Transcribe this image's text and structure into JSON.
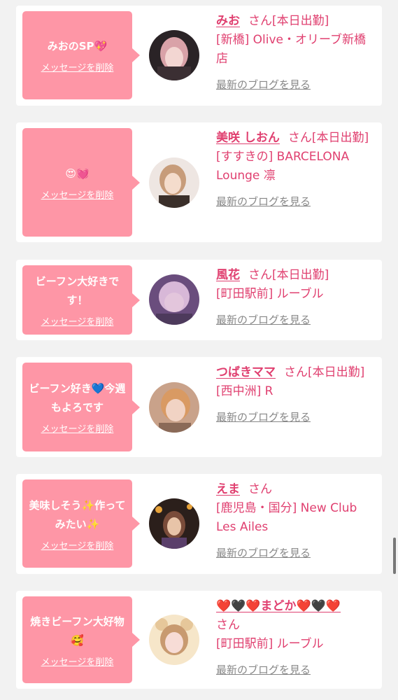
{
  "cards": [
    {
      "message": "みおのSP💖",
      "delete_label": "メッセージを削除",
      "name": "みお",
      "san": "さん",
      "status": "[本日出勤]",
      "shop": "[新橋] Olive・オリーブ新橋店",
      "blog_link": "最新のブログを見る",
      "avatar_icon": "girl-portrait-dark",
      "avatar_colors": [
        "#2a2326",
        "#d9a2a8",
        "#f3d6d2"
      ]
    },
    {
      "message": "😍💓",
      "delete_label": "メッセージを削除",
      "name": "美咲 しおん",
      "san": "さん",
      "status": "[本日出勤]",
      "shop": "[すすきの] BARCELONA Lounge 凛",
      "blog_link": "最新のブログを見る",
      "avatar_icon": "girl-portrait-light",
      "avatar_colors": [
        "#eee6e2",
        "#c79c7a",
        "#f4dccc"
      ]
    },
    {
      "message": "ビーフン大好きです！",
      "delete_label": "メッセージを削除",
      "name": "風花",
      "san": "さん",
      "status": "[本日出勤]",
      "shop": "[町田駅前] ルーブル",
      "blog_link": "最新のブログを見る",
      "avatar_icon": "girl-portrait-purple",
      "avatar_colors": [
        "#6a4d7d",
        "#d8b8d8",
        "#e3c6dc"
      ]
    },
    {
      "message": "ビーフン好き💙今週もよろです",
      "delete_label": "メッセージを削除",
      "name": "つばきママ",
      "san": "さん",
      "status": "[本日出勤]",
      "shop": "[西中洲] R",
      "blog_link": "最新のブログを見る",
      "avatar_icon": "girl-portrait-warm",
      "avatar_colors": [
        "#c9a28a",
        "#d99a63",
        "#f1d3c4"
      ]
    },
    {
      "message": "美味しそう✨作ってみたい✨",
      "delete_label": "メッセージを削除",
      "name": "えま",
      "san": "さん",
      "status": "",
      "shop": "[鹿児島・国分] New Club Les Ailes",
      "blog_link": "最新のブログを見る",
      "avatar_icon": "girl-portrait-night",
      "avatar_colors": [
        "#2b1f1b",
        "#e8a33a",
        "#e8c4a8"
      ]
    },
    {
      "message": "焼きビーフン大好物🥰",
      "delete_label": "メッセージを削除",
      "name": "❤️🖤❤️まどか❤️🖤❤️",
      "san": "さん",
      "status": "",
      "shop": "[町田駅前] ルーブル",
      "blog_link": "最新のブログを見る",
      "avatar_icon": "girl-portrait-bear-ears",
      "avatar_colors": [
        "#f6e6c9",
        "#e6c79a",
        "#f7dcd6"
      ]
    }
  ]
}
